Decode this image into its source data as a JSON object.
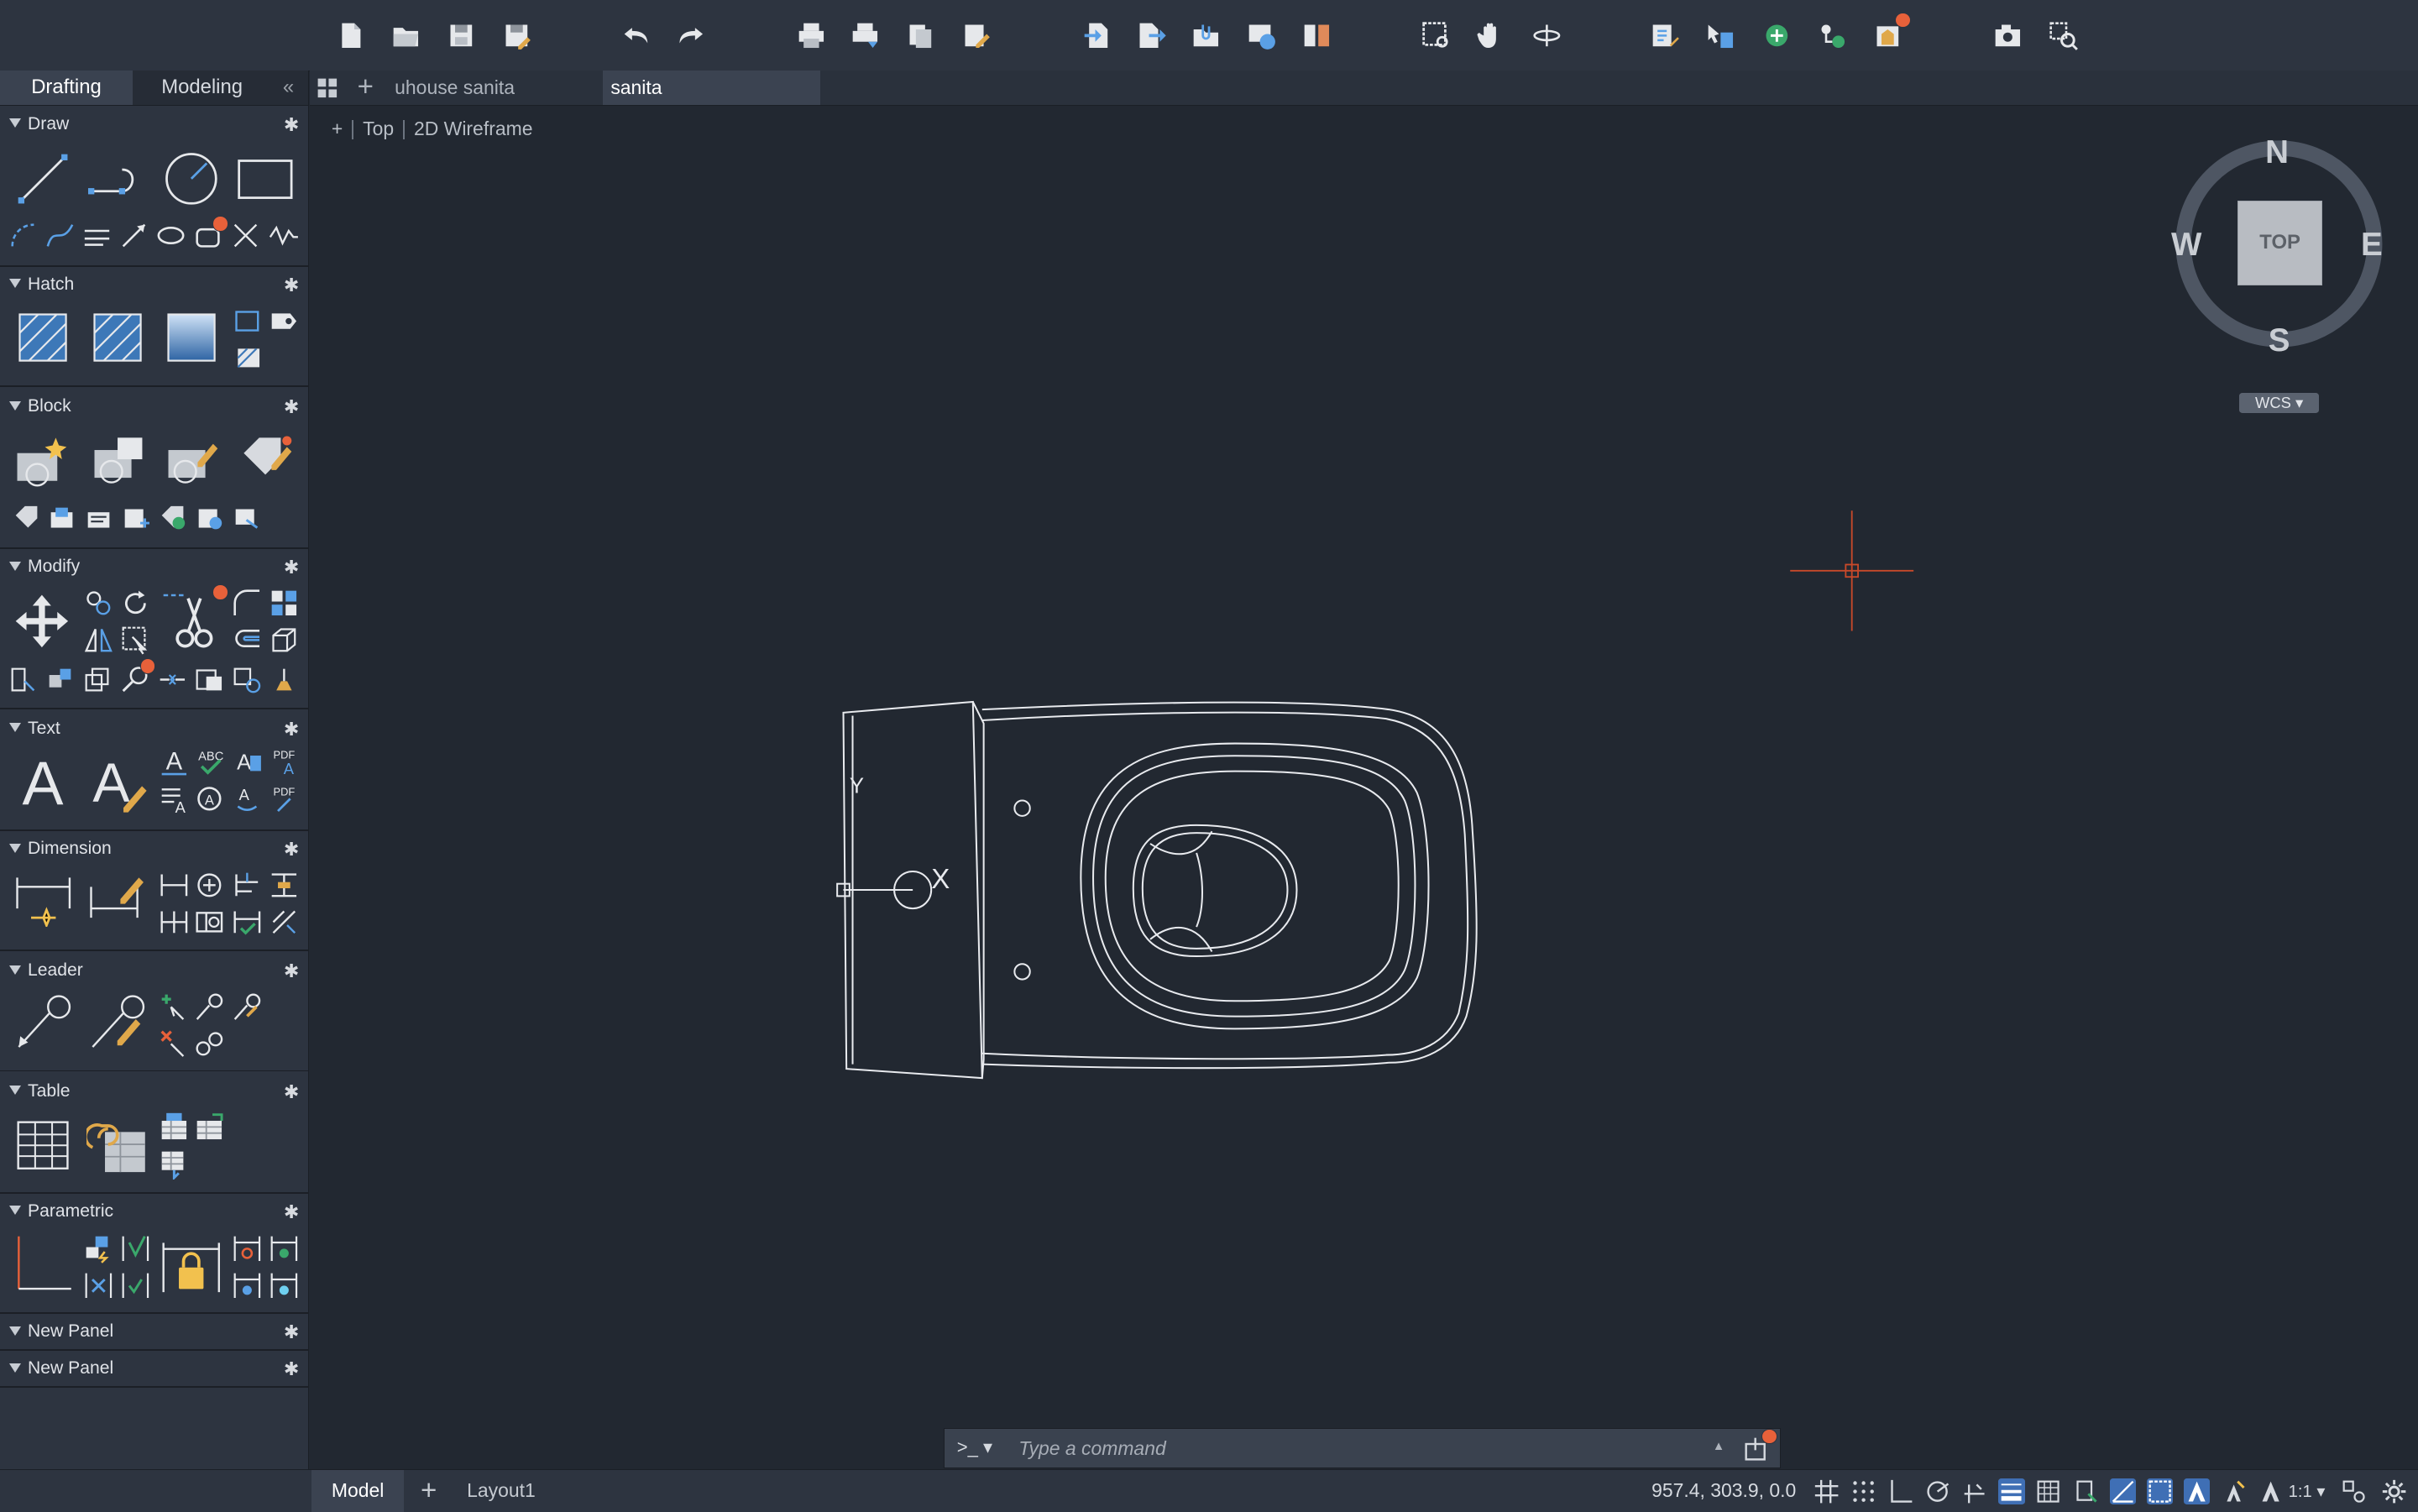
{
  "palette": {
    "tabs": [
      {
        "label": "Drafting",
        "active": true
      },
      {
        "label": "Modeling",
        "active": false
      }
    ],
    "collapse_icon": "chevron-double-left-icon",
    "sections": [
      {
        "label": "Draw"
      },
      {
        "label": "Hatch"
      },
      {
        "label": "Block"
      },
      {
        "label": "Modify"
      },
      {
        "label": "Text"
      },
      {
        "label": "Dimension"
      },
      {
        "label": "Leader"
      },
      {
        "label": "Table"
      },
      {
        "label": "Parametric"
      },
      {
        "label": "New Panel"
      },
      {
        "label": "New Panel"
      }
    ]
  },
  "doc_tabs": {
    "items": [
      {
        "label": "uhouse sanita",
        "active": false
      },
      {
        "label": "sanita",
        "active": true
      }
    ]
  },
  "viewport": {
    "plus": "+",
    "view": "Top",
    "visual_style": "2D Wireframe",
    "compass": {
      "n": "N",
      "s": "S",
      "e": "E",
      "w": "W"
    },
    "cube_face": "TOP",
    "ucs": "WCS ▾",
    "ucs_x": "X",
    "ucs_y": "Y"
  },
  "command_line": {
    "prompt": ">_ ▾",
    "placeholder": "Type a command",
    "expand": "▲"
  },
  "status_bar": {
    "tabs": [
      {
        "label": "Model",
        "active": true
      },
      {
        "label": "Layout1",
        "active": false
      }
    ],
    "add": "+",
    "coordinates": "957.4,  303.9, 0.0",
    "scale": "1:1 ▾"
  },
  "colors": {
    "background": "#222831",
    "panel": "#2d3440",
    "accent": "#3f6fb5",
    "badge": "#e8613a",
    "crosshair": "#c8492a"
  }
}
